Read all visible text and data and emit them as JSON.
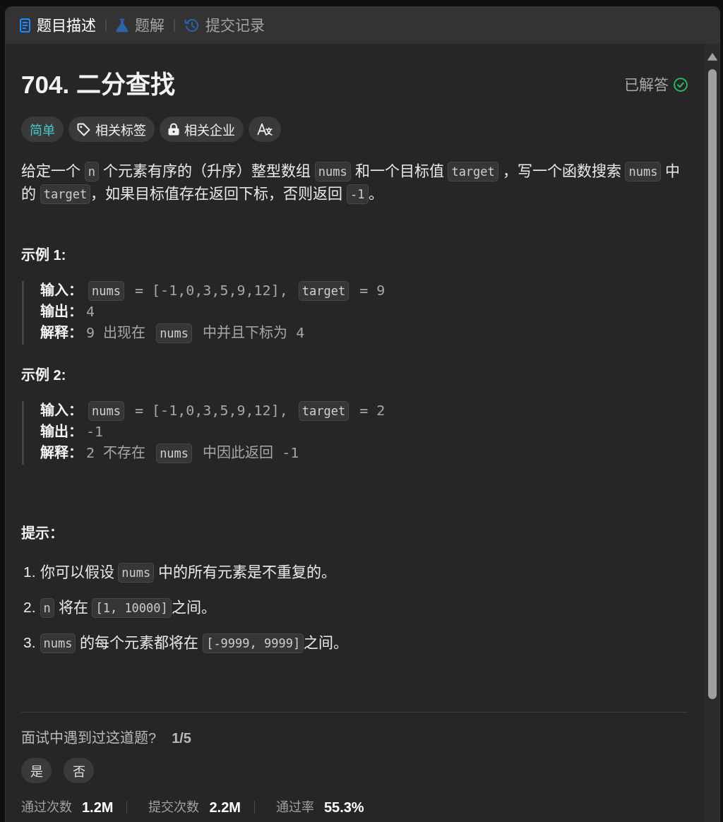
{
  "tabs": [
    {
      "kind": "description",
      "label": "题目描述",
      "selected": true
    },
    {
      "kind": "solutions",
      "label": "题解",
      "selected": false
    },
    {
      "kind": "submissions",
      "label": "提交记录",
      "selected": false
    }
  ],
  "problem": {
    "title": "704. 二分查找",
    "status": {
      "label": "已解答",
      "solved": true
    }
  },
  "tags": [
    {
      "kind": "difficulty",
      "label": "简单"
    },
    {
      "kind": "topics",
      "label": "相关标签"
    },
    {
      "kind": "companies",
      "label": "相关企业"
    },
    {
      "kind": "translate"
    }
  ],
  "description": [
    {
      "kind": "text",
      "text": "给定一个 "
    },
    {
      "kind": "code",
      "text": "n"
    },
    {
      "kind": "text",
      "text": " 个元素有序的（升序）整型数组 "
    },
    {
      "kind": "code",
      "text": "nums"
    },
    {
      "kind": "text",
      "text": " 和一个目标值 "
    },
    {
      "kind": "code",
      "text": "target"
    },
    {
      "kind": "text",
      "text": " ，写一个函数搜索 "
    },
    {
      "kind": "code",
      "text": "nums"
    },
    {
      "kind": "text",
      "text": " 中的 "
    },
    {
      "kind": "code",
      "text": "target"
    },
    {
      "kind": "text",
      "text": "，如果目标值存在返回下标，否则返回 "
    },
    {
      "kind": "code",
      "text": "-1"
    },
    {
      "kind": "text",
      "text": "。"
    }
  ],
  "examples": [
    {
      "title": "示例 1:",
      "lines": [
        {
          "label": "输入：",
          "parts": [
            {
              "kind": "code",
              "text": "nums"
            },
            {
              "kind": "text",
              "text": " = [-1,0,3,5,9,12], "
            },
            {
              "kind": "code",
              "text": "target"
            },
            {
              "kind": "text",
              "text": " = 9"
            }
          ]
        },
        {
          "label": "输出：",
          "parts": [
            {
              "kind": "text",
              "text": "4"
            }
          ]
        },
        {
          "label": "解释：",
          "parts": [
            {
              "kind": "text",
              "text": "9 出现在 "
            },
            {
              "kind": "code",
              "text": "nums"
            },
            {
              "kind": "text",
              "text": " 中并且下标为 4"
            }
          ]
        }
      ]
    },
    {
      "title": "示例 2:",
      "lines": [
        {
          "label": "输入：",
          "parts": [
            {
              "kind": "code",
              "text": "nums"
            },
            {
              "kind": "text",
              "text": " = [-1,0,3,5,9,12], "
            },
            {
              "kind": "code",
              "text": "target"
            },
            {
              "kind": "text",
              "text": " = 2"
            }
          ]
        },
        {
          "label": "输出：",
          "parts": [
            {
              "kind": "text",
              "text": "-1"
            }
          ]
        },
        {
          "label": "解释：",
          "parts": [
            {
              "kind": "text",
              "text": "2 不存在 "
            },
            {
              "kind": "code",
              "text": "nums"
            },
            {
              "kind": "text",
              "text": " 中因此返回 -1"
            }
          ]
        }
      ]
    }
  ],
  "constraints": {
    "title": "提示：",
    "items": [
      {
        "number": "1.",
        "parts": [
          {
            "kind": "text",
            "text": "你可以假设 "
          },
          {
            "kind": "code",
            "text": "nums"
          },
          {
            "kind": "text",
            "text": " 中的所有元素是不重复的。"
          }
        ]
      },
      {
        "number": "2.",
        "parts": [
          {
            "kind": "code",
            "text": "n"
          },
          {
            "kind": "text",
            "text": " 将在 "
          },
          {
            "kind": "code",
            "text": "[1, 10000]"
          },
          {
            "kind": "text",
            "text": "之间。"
          }
        ]
      },
      {
        "number": "3.",
        "parts": [
          {
            "kind": "code",
            "text": "nums"
          },
          {
            "kind": "text",
            "text": " 的每个元素都将在 "
          },
          {
            "kind": "code",
            "text": "[-9999, 9999]"
          },
          {
            "kind": "text",
            "text": "之间。"
          }
        ]
      }
    ]
  },
  "interview": {
    "question": "面试中遇到过这道题?",
    "count": "1/5",
    "buttons": [
      "是",
      "否"
    ]
  },
  "stats": [
    {
      "label": "通过次数",
      "value": "1.2M"
    },
    {
      "label": "提交次数",
      "value": "2.2M"
    },
    {
      "label": "通过率",
      "value": "55.3%"
    }
  ]
}
